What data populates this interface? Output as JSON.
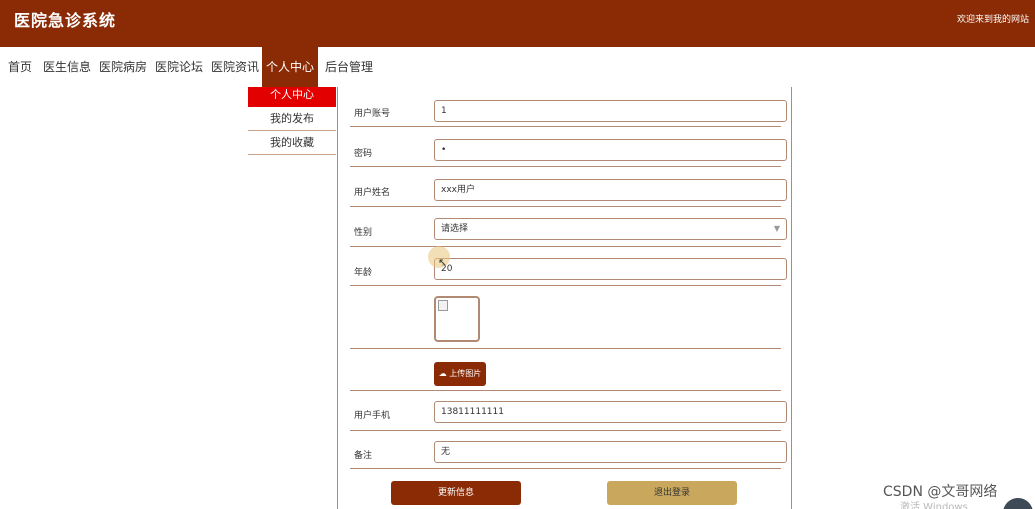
{
  "header": {
    "title": "医院急诊系统",
    "welcome": "欢迎来到我的网站"
  },
  "nav": {
    "items": [
      {
        "label": "首页"
      },
      {
        "label": "医生信息"
      },
      {
        "label": "医院病房"
      },
      {
        "label": "医院论坛"
      },
      {
        "label": "医院资讯"
      },
      {
        "label": "个人中心",
        "active": true
      },
      {
        "label": "后台管理"
      }
    ]
  },
  "submenu": {
    "items": [
      {
        "label": "个人中心",
        "active": true
      },
      {
        "label": "我的发布"
      },
      {
        "label": "我的收藏"
      }
    ]
  },
  "form": {
    "account": {
      "label": "用户账号",
      "value": "1"
    },
    "password": {
      "label": "密码",
      "value": "•"
    },
    "name": {
      "label": "用户姓名",
      "value": "xxx用户"
    },
    "gender": {
      "label": "性别",
      "placeholder": "请选择"
    },
    "age": {
      "label": "年龄",
      "value": "20"
    },
    "upload_label": "上传图片",
    "phone": {
      "label": "用户手机",
      "value": "13811111111"
    },
    "remark": {
      "label": "备注",
      "value": "无"
    }
  },
  "buttons": {
    "update": "更新信息",
    "logout": "退出登录"
  },
  "watermark": {
    "csdn": "CSDN @文哥网络",
    "windows": "激活 Windows"
  },
  "colors": {
    "brand": "#8a2b05",
    "submenu_active": "#e30000",
    "logout": "#c9a85e",
    "border": "#b28a74"
  },
  "icons": {
    "upload": "cloud-upload-icon",
    "select": "chevron-down-icon",
    "broken_image": "broken-image-icon",
    "cursor": "mouse-pointer-icon"
  }
}
